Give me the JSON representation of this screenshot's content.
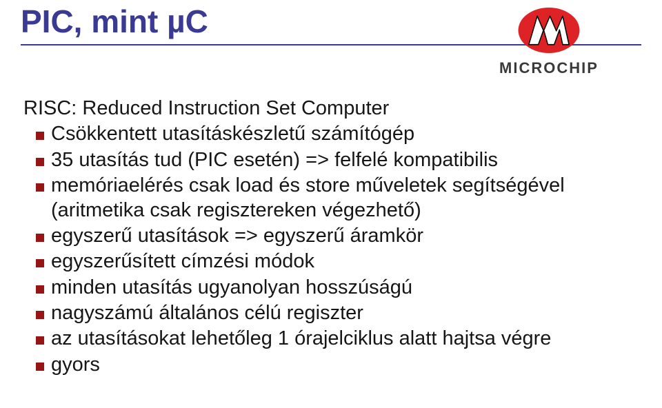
{
  "title": "PIC, mint µC",
  "logo": {
    "word": "MICROCHIP",
    "fill": "#de2327",
    "icon_name": "microchip-logo"
  },
  "body": {
    "heading": "RISC: Reduced Instruction Set Computer",
    "items": [
      {
        "level": 1,
        "text": "Csökkentett utasításkészletű számítógép"
      },
      {
        "level": 1,
        "text": "35 utasítás tud (PIC esetén) => felfelé kompatibilis"
      },
      {
        "level": 1,
        "text": "memóriaelérés csak load és store műveletek segítségével (aritmetika csak regisztereken végezhető)"
      },
      {
        "level": 1,
        "text": "egyszerű utasítások => egyszerű áramkör"
      },
      {
        "level": 1,
        "text": "egyszerűsített címzési módok"
      },
      {
        "level": 1,
        "text": "minden utasítás ugyanolyan hosszúságú"
      },
      {
        "level": 1,
        "text": "nagyszámú általános célú regiszter"
      },
      {
        "level": 1,
        "text": "az utasításokat lehetőleg 1 órajelciklus alatt hajtsa végre"
      },
      {
        "level": 1,
        "text": "gyors"
      }
    ]
  }
}
